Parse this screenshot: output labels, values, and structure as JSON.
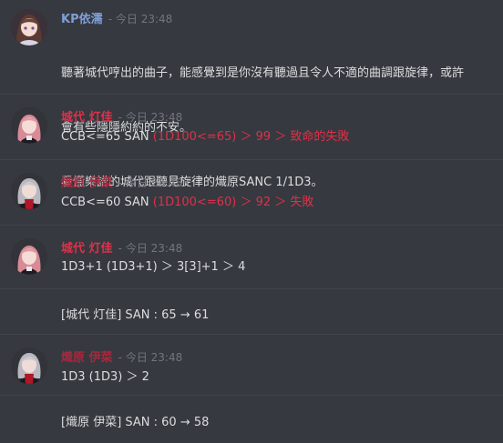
{
  "messages": [
    {
      "author": "KP依濡",
      "author_color": "#7f9fd6",
      "timestamp": "- 今日 23:48",
      "lines": [
        "聽著城代哼出的曲子，能感覺到是你沒有聽過且令人不適的曲調跟旋律，或許",
        "會有些隱隱約約的不安。",
        "看懂樂譜的城代跟聽見旋律的熾原SANC 1/1D3。"
      ]
    },
    {
      "author": "城代 灯佳",
      "author_color": "#e0304a",
      "timestamp": "- 今日 23:48",
      "text_plain": "CCB<=65 SAN ",
      "text_red": "(1D100<=65) ＞ 99 ＞ 致命的失敗"
    },
    {
      "author": "熾原 伊菜",
      "author_color": "#a8283e",
      "timestamp": "- 今日 23:48",
      "text_plain": "CCB<=60 SAN ",
      "text_red": "(1D100<=60) ＞ 92 ＞ 失敗"
    },
    {
      "author": "城代 灯佳",
      "author_color": "#e0304a",
      "timestamp": "- 今日 23:48",
      "text": "1D3+1 (1D3+1) ＞ 3[3]+1 ＞ 4"
    },
    {
      "system": "[城代 灯佳] SAN : 65 → 61"
    },
    {
      "author": "熾原 伊菜",
      "author_color": "#a8283e",
      "timestamp": "- 今日 23:48",
      "text": "1D3 (1D3) ＞ 2"
    },
    {
      "system": "[熾原 伊菜] SAN : 60 → 58"
    }
  ]
}
